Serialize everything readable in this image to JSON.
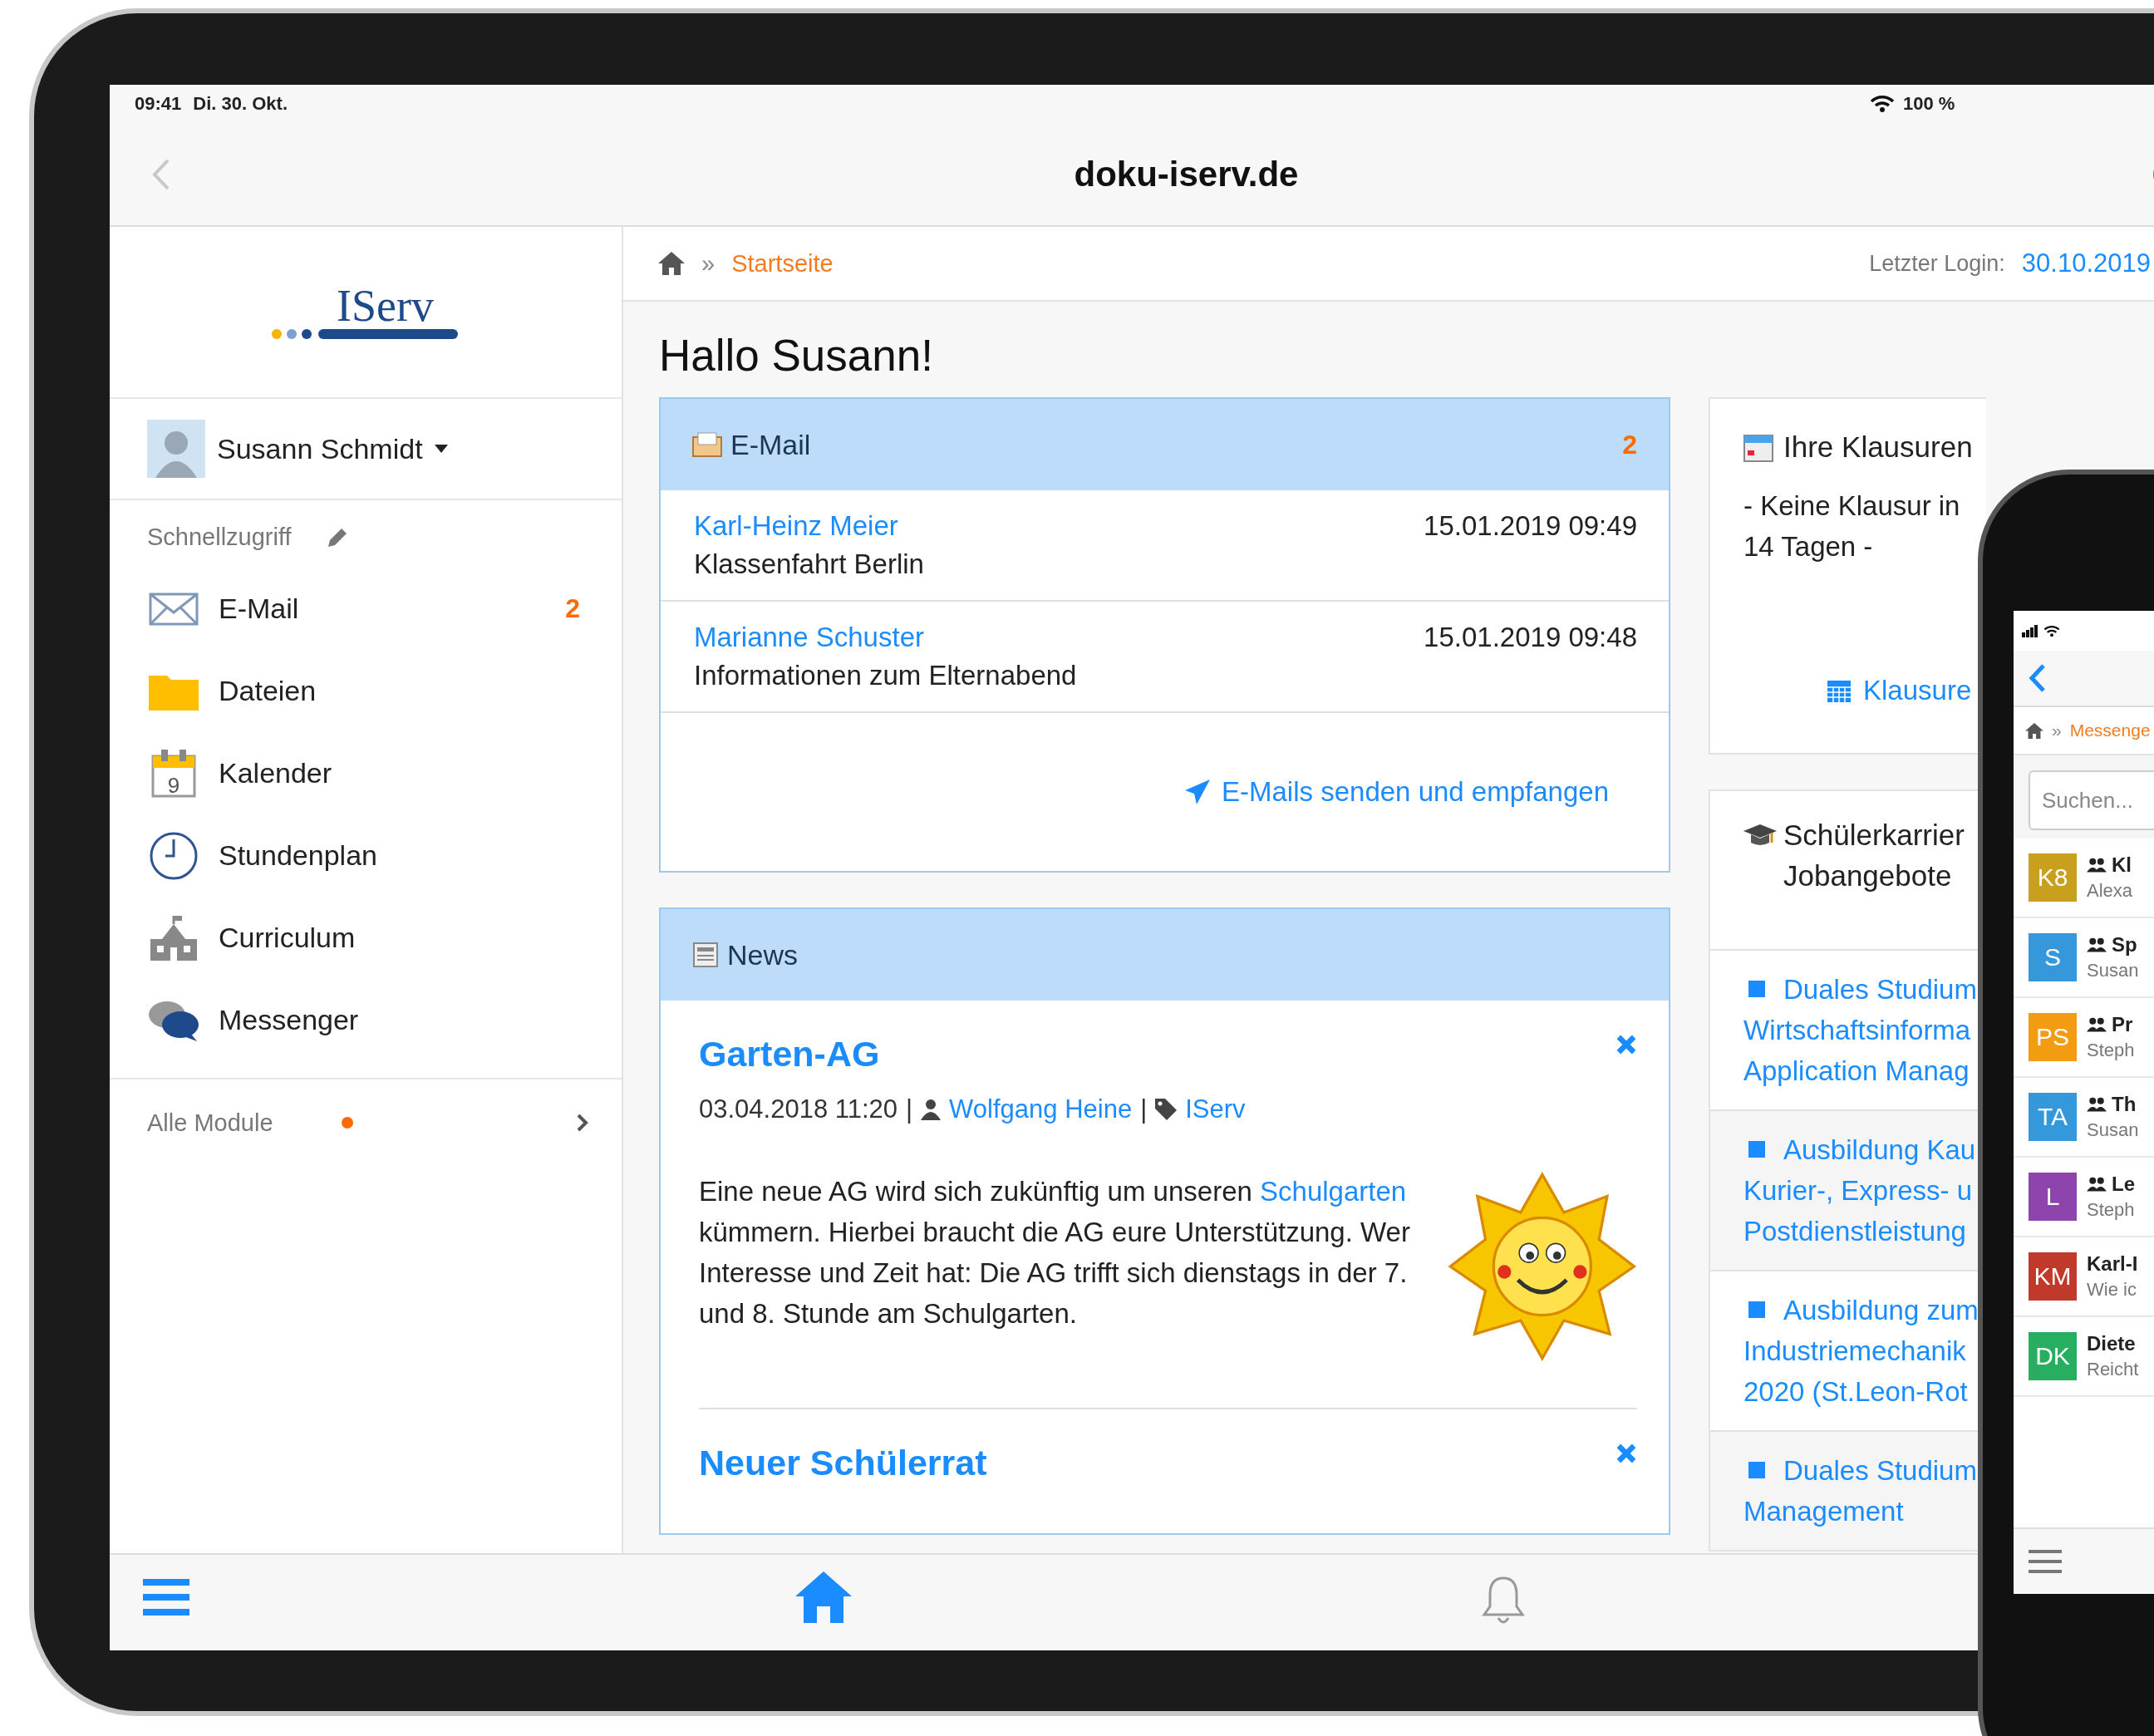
{
  "status_bar": {
    "time": "09:41",
    "date": "Di. 30. Okt.",
    "battery": "100 %"
  },
  "nav_bar": {
    "title": "doku-iserv.de"
  },
  "sidebar": {
    "logo": "IServ",
    "user": {
      "name": "Susann Schmidt"
    },
    "quick_access_label": "Schnellzugriff",
    "items": [
      {
        "label": "E-Mail",
        "kind": "mail",
        "badge": "2"
      },
      {
        "label": "Dateien",
        "kind": "folder"
      },
      {
        "label": "Kalender",
        "kind": "calendar",
        "icon_label": "9"
      },
      {
        "label": "Stundenplan",
        "kind": "clock"
      },
      {
        "label": "Curriculum",
        "kind": "school"
      },
      {
        "label": "Messenger",
        "kind": "chat"
      }
    ],
    "all_modules": {
      "label": "Alle Module",
      "has_new": true
    }
  },
  "breadcrumb": {
    "separator": "»",
    "current": "Startseite"
  },
  "last_login": {
    "label": "Letzter Login:",
    "value": "30.10.2019"
  },
  "greeting": "Hallo Susann!",
  "email_panel": {
    "title": "E-Mail",
    "count": "2",
    "messages": [
      {
        "sender": "Karl-Heinz Meier",
        "subject": "Klassenfahrt Berlin",
        "date": "15.01.2019 09:49"
      },
      {
        "sender": "Marianne Schuster",
        "subject": "Informationen zum Elternabend",
        "date": "15.01.2019 09:48"
      }
    ],
    "link": "E-Mails senden und empfangen"
  },
  "news_panel": {
    "title": "News",
    "items": [
      {
        "title": "Garten-AG",
        "date": "03.04.2018 11:20",
        "separator": "|",
        "author": "Wolfgang Heine",
        "tag": "IServ",
        "body_before": "Eine neue AG wird sich zukünftig um unseren ",
        "body_link": "Schulgarten",
        "body_after": " kümmern. Hierbei braucht die AG eure Unterstützung. Wer Interesse und Zeit hat: Die AG trifft sich dienstags in der 7. und 8. Stunde am Schulgarten.",
        "kind": "illustrated"
      },
      {
        "title": "Neuer Schülerrat"
      }
    ]
  },
  "exams_card": {
    "title": "Ihre Klausuren",
    "text": "- Keine Klausur in\n14 Tagen -",
    "link": "Klausure"
  },
  "jobs_card": {
    "title": "Schülerkarrier\nJobangebote",
    "items": [
      {
        "text": "Duales Studium\nWirtschaftsinforma\nApplication Manag"
      },
      {
        "text": "Ausbildung Kau\nKurier-, Express- u\nPostdienstleistung"
      },
      {
        "text": "Ausbildung zum\nIndustriemechanik\n2020 (St.Leon-Rot"
      },
      {
        "text": "Duales Studium\nManagement"
      }
    ]
  },
  "phone": {
    "breadcrumb_separator": "»",
    "breadcrumb": "Messenge",
    "search_placeholder": "Suchen...",
    "chats": [
      {
        "initials": "K8",
        "color": "#c9a01e",
        "group": true,
        "title": "Kl",
        "subtitle": "Alexa"
      },
      {
        "initials": "S",
        "color": "#3498db",
        "group": true,
        "title": "Sp",
        "subtitle": "Susan"
      },
      {
        "initials": "PS",
        "color": "#f39c12",
        "group": true,
        "title": "Pr",
        "subtitle": "Steph"
      },
      {
        "initials": "TA",
        "color": "#3498db",
        "group": true,
        "title": "Th",
        "subtitle": "Susan"
      },
      {
        "initials": "L",
        "color": "#8e44ad",
        "group": true,
        "title": "Le",
        "subtitle": "Steph"
      },
      {
        "initials": "KM",
        "color": "#c0392b",
        "group": false,
        "title": "Karl-I",
        "subtitle": "Wie ic"
      },
      {
        "initials": "DK",
        "color": "#27ae60",
        "group": false,
        "title": "Diete",
        "subtitle": "Reicht"
      }
    ]
  }
}
